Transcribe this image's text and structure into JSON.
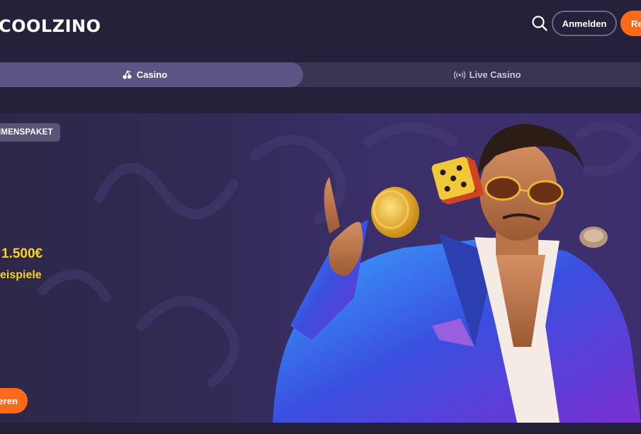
{
  "header": {
    "logo_text": "COOLZINO",
    "search_icon": "search-icon",
    "login_label": "Anmelden",
    "register_label": "Re"
  },
  "tabs": [
    {
      "label": "Casino",
      "icon": "cherries-icon",
      "active": true
    },
    {
      "label": "Live Casino",
      "icon": "broadcast-icon",
      "active": false
    }
  ],
  "hero": {
    "badge": "IMENSPAKET",
    "amount": "1.500€",
    "amount_prefix": "",
    "spins": "eispiele",
    "cta_label": "eren"
  },
  "colors": {
    "background": "#26213a",
    "accent": "#ff6a1a",
    "highlight": "#ffd21a",
    "tab_active": "#5d5484",
    "tab_bar": "#3b3553"
  }
}
